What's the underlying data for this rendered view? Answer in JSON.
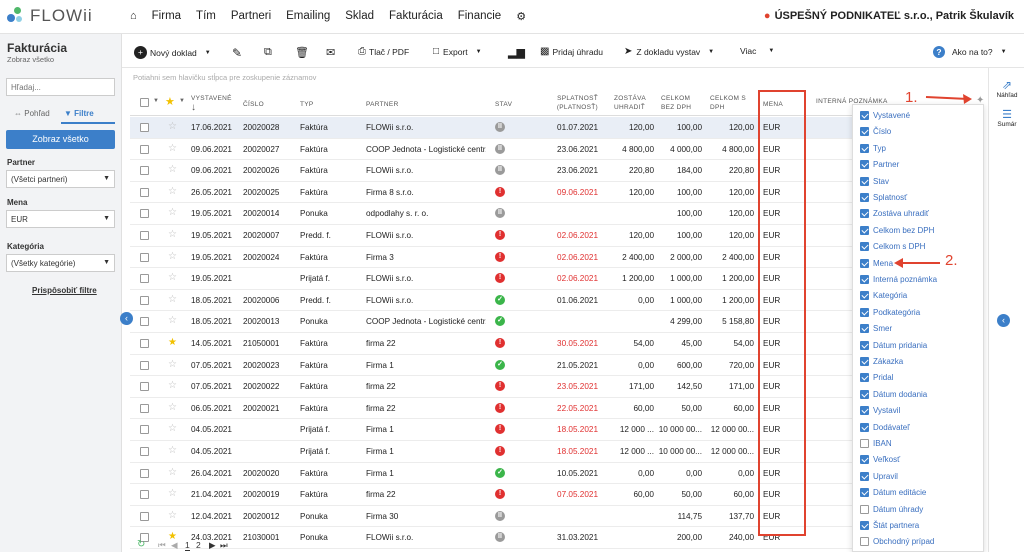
{
  "app": {
    "logo": "FLOWii",
    "company": "ÚSPEŠNÝ PODNIKATEĽ s.r.o., Patrik Škulavík"
  },
  "nav": [
    "Firma",
    "Tím",
    "Partneri",
    "Emailing",
    "Sklad",
    "Fakturácia",
    "Financie"
  ],
  "sidebar": {
    "title": "Fakturácia",
    "subtitle": "Zobraz všetko",
    "search_placeholder": "Hľadaj...",
    "tab_view": "Pohľad",
    "tab_filters": "Filtre",
    "show_all": "Zobraz všetko",
    "partner_label": "Partner",
    "partner_value": "(Všetci partneri)",
    "currency_label": "Mena",
    "currency_value": "EUR",
    "category_label": "Kategória",
    "category_value": "(Všetky kategórie)",
    "customize": "Prispôsobiť filtre"
  },
  "toolbar": {
    "new_doc": "Nový doklad",
    "print": "Tlač / PDF",
    "export": "Export",
    "add_payment": "Pridaj úhradu",
    "from_doc": "Z dokladu vystav",
    "more": "Viac",
    "help": "Ako na to?"
  },
  "right_panel": {
    "preview": "Náhľad",
    "summary": "Sumár"
  },
  "grid": {
    "hint": "Potiahni sem hlavičku stĺpca pre zoskupenie záznamov",
    "headers": {
      "issued": "VYSTAVENÉ",
      "number": "ČÍSLO",
      "type": "TYP",
      "partner": "PARTNER",
      "status": "STAV",
      "due": "SPLATNOSŤ",
      "due2": "(PLATNOSŤ)",
      "remaining": "ZOSTÁVA",
      "remaining2": "UHRADIŤ",
      "total_ex": "CELKOM",
      "total_ex2": "BEZ DPH",
      "total_inc": "CELKOM S",
      "total_inc2": "DPH",
      "currency": "MENA",
      "note": "INTERNÁ POZNÁMKA"
    },
    "rows": [
      {
        "star": false,
        "issued": "17.06.2021",
        "number": "20020028",
        "type": "Faktúra",
        "partner": "FLOWii s.r.o.",
        "status": "gray",
        "due": "01.07.2021",
        "due_red": false,
        "remaining": "120,00",
        "total_ex": "100,00",
        "total_inc": "120,00",
        "currency": "EUR"
      },
      {
        "star": false,
        "issued": "09.06.2021",
        "number": "20020027",
        "type": "Faktúra",
        "partner": "COOP Jednota - Logistické centr...",
        "status": "gray",
        "due": "23.06.2021",
        "due_red": false,
        "remaining": "4 800,00",
        "total_ex": "4 000,00",
        "total_inc": "4 800,00",
        "currency": "EUR"
      },
      {
        "star": false,
        "issued": "09.06.2021",
        "number": "20020026",
        "type": "Faktúra",
        "partner": "FLOWii s.r.o.",
        "status": "gray",
        "due": "23.06.2021",
        "due_red": false,
        "remaining": "220,80",
        "total_ex": "184,00",
        "total_inc": "220,80",
        "currency": "EUR"
      },
      {
        "star": false,
        "issued": "26.05.2021",
        "number": "20020025",
        "type": "Faktúra",
        "partner": "Firma 8 s.r.o.",
        "status": "red",
        "due": "09.06.2021",
        "due_red": true,
        "remaining": "120,00",
        "total_ex": "100,00",
        "total_inc": "120,00",
        "currency": "EUR"
      },
      {
        "star": false,
        "issued": "19.05.2021",
        "number": "20020014",
        "type": "Ponuka",
        "partner": "odpodlahy s. r. o.",
        "status": "gray",
        "due": "",
        "due_red": false,
        "remaining": "",
        "total_ex": "100,00",
        "total_inc": "120,00",
        "currency": "EUR"
      },
      {
        "star": false,
        "issued": "19.05.2021",
        "number": "20020007",
        "type": "Predd. f.",
        "partner": "FLOWii s.r.o.",
        "status": "red",
        "due": "02.06.2021",
        "due_red": true,
        "remaining": "120,00",
        "total_ex": "100,00",
        "total_inc": "120,00",
        "currency": "EUR"
      },
      {
        "star": false,
        "issued": "19.05.2021",
        "number": "20020024",
        "type": "Faktúra",
        "partner": "Firma 3",
        "status": "red",
        "due": "02.06.2021",
        "due_red": true,
        "remaining": "2 400,00",
        "total_ex": "2 000,00",
        "total_inc": "2 400,00",
        "currency": "EUR"
      },
      {
        "star": false,
        "issued": "19.05.2021",
        "number": "",
        "type": "Prijatá f.",
        "partner": "FLOWii s.r.o.",
        "status": "red",
        "due": "02.06.2021",
        "due_red": true,
        "remaining": "1 200,00",
        "total_ex": "1 000,00",
        "total_inc": "1 200,00",
        "currency": "EUR"
      },
      {
        "star": false,
        "issued": "18.05.2021",
        "number": "20020006",
        "type": "Predd. f.",
        "partner": "FLOWii s.r.o.",
        "status": "green",
        "due": "01.06.2021",
        "due_red": false,
        "remaining": "0,00",
        "total_ex": "1 000,00",
        "total_inc": "1 200,00",
        "currency": "EUR"
      },
      {
        "star": false,
        "issued": "18.05.2021",
        "number": "20020013",
        "type": "Ponuka",
        "partner": "COOP Jednota - Logistické centr...",
        "status": "green",
        "due": "",
        "due_red": false,
        "remaining": "",
        "total_ex": "4 299,00",
        "total_inc": "5 158,80",
        "currency": "EUR"
      },
      {
        "star": true,
        "issued": "14.05.2021",
        "number": "21050001",
        "type": "Faktúra",
        "partner": "firma 22",
        "status": "red",
        "due": "30.05.2021",
        "due_red": true,
        "remaining": "54,00",
        "total_ex": "45,00",
        "total_inc": "54,00",
        "currency": "EUR"
      },
      {
        "star": false,
        "issued": "07.05.2021",
        "number": "20020023",
        "type": "Faktúra",
        "partner": "Firma 1",
        "status": "green",
        "due": "21.05.2021",
        "due_red": false,
        "remaining": "0,00",
        "total_ex": "600,00",
        "total_inc": "720,00",
        "currency": "EUR"
      },
      {
        "star": false,
        "issued": "07.05.2021",
        "number": "20020022",
        "type": "Faktúra",
        "partner": "firma 22",
        "status": "red",
        "due": "23.05.2021",
        "due_red": true,
        "remaining": "171,00",
        "total_ex": "142,50",
        "total_inc": "171,00",
        "currency": "EUR"
      },
      {
        "star": false,
        "issued": "06.05.2021",
        "number": "20020021",
        "type": "Faktúra",
        "partner": "firma 22",
        "status": "red",
        "due": "22.05.2021",
        "due_red": true,
        "remaining": "60,00",
        "total_ex": "50,00",
        "total_inc": "60,00",
        "currency": "EUR"
      },
      {
        "star": false,
        "issued": "04.05.2021",
        "number": "",
        "type": "Prijatá f.",
        "partner": "Firma 1",
        "status": "red",
        "due": "18.05.2021",
        "due_red": true,
        "remaining": "12 000 ...",
        "total_ex": "10 000 00...",
        "total_inc": "12 000 00...",
        "currency": "EUR"
      },
      {
        "star": false,
        "issued": "04.05.2021",
        "number": "",
        "type": "Prijatá f.",
        "partner": "Firma 1",
        "status": "red",
        "due": "18.05.2021",
        "due_red": true,
        "remaining": "12 000 ...",
        "total_ex": "10 000 00...",
        "total_inc": "12 000 00...",
        "currency": "EUR"
      },
      {
        "star": false,
        "issued": "26.04.2021",
        "number": "20020020",
        "type": "Faktúra",
        "partner": "Firma 1",
        "status": "green",
        "due": "10.05.2021",
        "due_red": false,
        "remaining": "0,00",
        "total_ex": "0,00",
        "total_inc": "0,00",
        "currency": "EUR"
      },
      {
        "star": false,
        "issued": "21.04.2021",
        "number": "20020019",
        "type": "Faktúra",
        "partner": "firma 22",
        "status": "red",
        "due": "07.05.2021",
        "due_red": true,
        "remaining": "60,00",
        "total_ex": "50,00",
        "total_inc": "60,00",
        "currency": "EUR"
      },
      {
        "star": false,
        "issued": "12.04.2021",
        "number": "20020012",
        "type": "Ponuka",
        "partner": "Firma 30",
        "status": "gray",
        "due": "",
        "due_red": false,
        "remaining": "",
        "total_ex": "114,75",
        "total_inc": "137,70",
        "currency": "EUR"
      },
      {
        "star": true,
        "issued": "24.03.2021",
        "number": "21030001",
        "type": "Ponuka",
        "partner": "FLOWii s.r.o.",
        "status": "gray",
        "due": "31.03.2021",
        "due_red": false,
        "remaining": "",
        "total_ex": "200,00",
        "total_inc": "240,00",
        "currency": "EUR"
      }
    ]
  },
  "columns_menu": [
    {
      "label": "Vystavené",
      "checked": true
    },
    {
      "label": "Číslo",
      "checked": true
    },
    {
      "label": "Typ",
      "checked": true
    },
    {
      "label": "Partner",
      "checked": true
    },
    {
      "label": "Stav",
      "checked": true
    },
    {
      "label": "Splatnosť",
      "checked": true
    },
    {
      "label": "Zostáva uhradiť",
      "checked": true
    },
    {
      "label": "Celkom bez DPH",
      "checked": true
    },
    {
      "label": "Celkom s DPH",
      "checked": true
    },
    {
      "label": "Mena",
      "checked": true
    },
    {
      "label": "Interná poznámka",
      "checked": true
    },
    {
      "label": "Kategória",
      "checked": true
    },
    {
      "label": "Podkategória",
      "checked": true
    },
    {
      "label": "Smer",
      "checked": true
    },
    {
      "label": "Dátum pridania",
      "checked": true
    },
    {
      "label": "Zákazka",
      "checked": true
    },
    {
      "label": "Pridal",
      "checked": true
    },
    {
      "label": "Dátum dodania",
      "checked": true
    },
    {
      "label": "Vystavil",
      "checked": true
    },
    {
      "label": "Dodávateľ",
      "checked": true
    },
    {
      "label": "IBAN",
      "checked": false
    },
    {
      "label": "Veľkosť",
      "checked": true
    },
    {
      "label": "Upravil",
      "checked": true
    },
    {
      "label": "Dátum editácie",
      "checked": true
    },
    {
      "label": "Dátum úhrady",
      "checked": false
    },
    {
      "label": "Štát partnera",
      "checked": true
    },
    {
      "label": "Obchodný prípad",
      "checked": false
    }
  ],
  "annotations": {
    "one": "1.",
    "two": "2."
  },
  "pager": {
    "p1": "1",
    "p2": "2"
  },
  "colors": {
    "accent": "#3c7fc9",
    "annotation": "#e0432f",
    "status_red": "#e03030",
    "status_green": "#3bb54a",
    "status_gray": "#9a9a9a"
  }
}
